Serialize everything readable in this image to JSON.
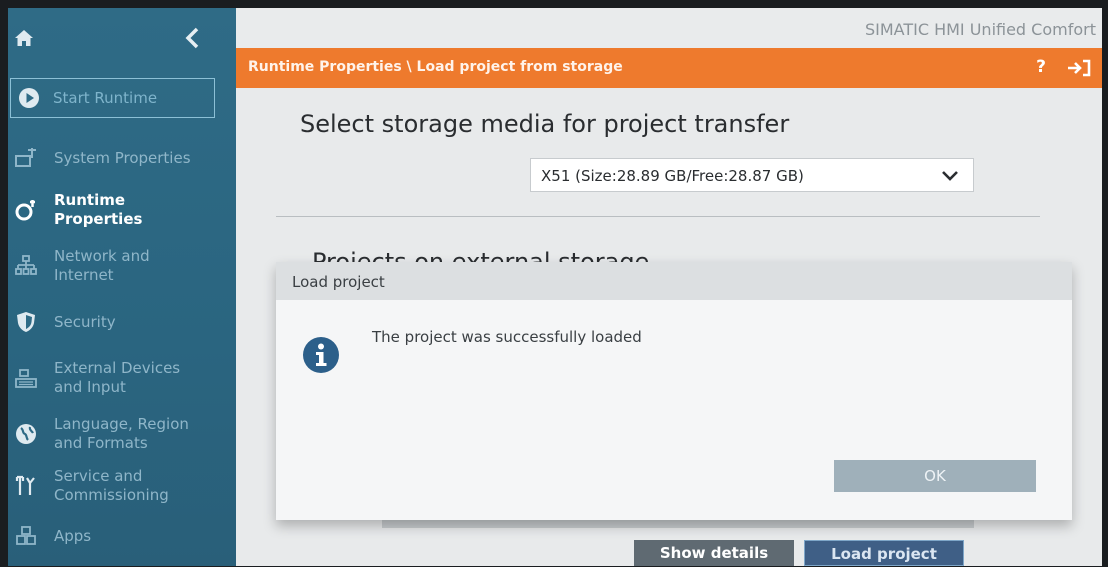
{
  "window": {
    "brand": "SIMATIC HMI Unified Comfort"
  },
  "header": {
    "breadcrumb": "Runtime Properties \\ Load project from storage",
    "help": "?"
  },
  "sidebar": {
    "items": [
      {
        "label": "Start Runtime",
        "icon": "play-icon"
      },
      {
        "label": "System Properties",
        "icon": "system-properties-icon"
      },
      {
        "label": "Runtime\nProperties",
        "icon": "runtime-properties-icon"
      },
      {
        "label": "Network and\nInternet",
        "icon": "network-icon"
      },
      {
        "label": "Security",
        "icon": "shield-icon"
      },
      {
        "label": "External Devices\nand Input",
        "icon": "devices-icon"
      },
      {
        "label": "Language, Region\nand Formats",
        "icon": "globe-icon"
      },
      {
        "label": "Service and\nCommissioning",
        "icon": "tools-icon"
      },
      {
        "label": "Apps",
        "icon": "apps-icon"
      }
    ]
  },
  "main": {
    "select_title": "Select storage media for project transfer",
    "storage_selected": "X51 (Size:28.89 GB/Free:28.87 GB)",
    "projects_title": "Projects on external storage",
    "show_details": "Show details",
    "load_project": "Load project"
  },
  "dialog": {
    "title": "Load project",
    "message": "The project was successfully loaded",
    "ok": "OK"
  },
  "colors": {
    "accent": "#ee7a2d",
    "sidebar": "#2f6b86"
  }
}
